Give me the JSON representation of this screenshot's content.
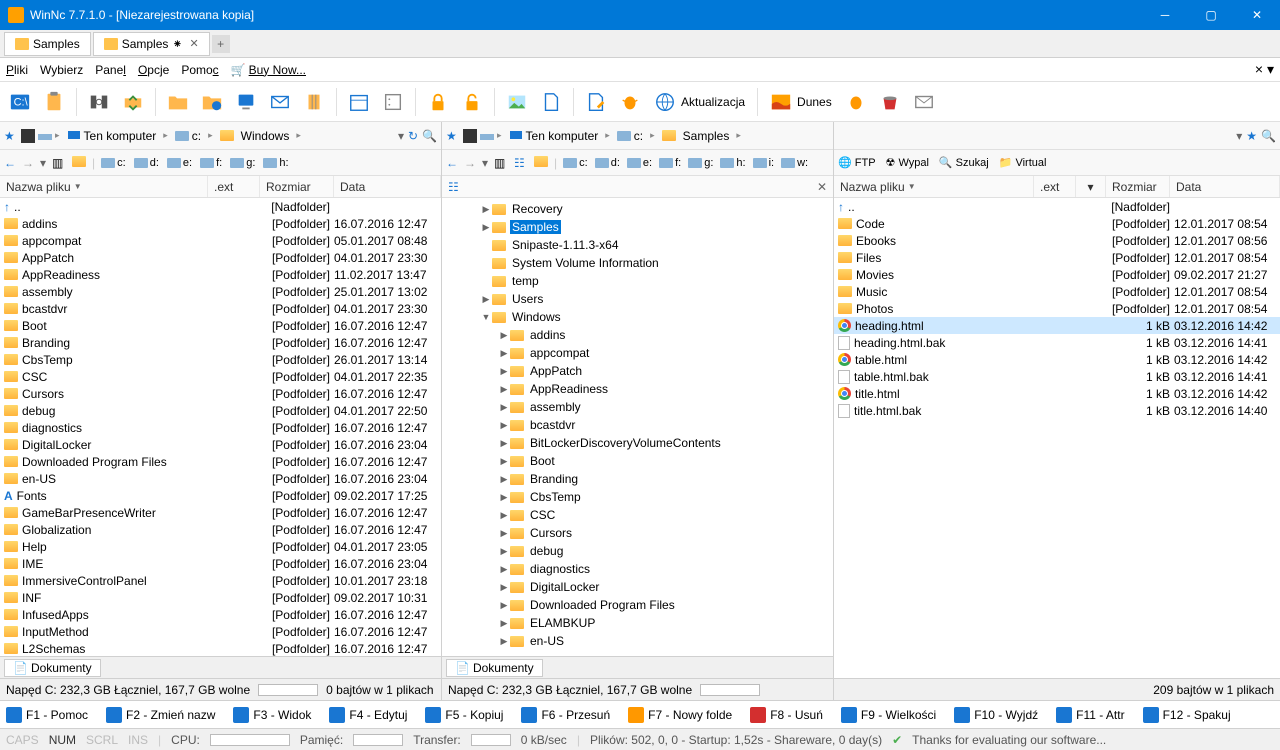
{
  "titlebar": {
    "title": "WinNc 7.7.1.0 - [Niezarejestrowana kopia]"
  },
  "tabs": [
    {
      "label": "Samples"
    },
    {
      "label": "Samples",
      "modified": true
    }
  ],
  "menu": {
    "file": "Pliki",
    "select": "Wybierz",
    "panel": "Panel",
    "options": "Opcje",
    "help": "Pomoc",
    "buy": "Buy Now..."
  },
  "toolbar_labels": {
    "update": "Aktualizacja",
    "dunes": "Dunes"
  },
  "left": {
    "breadcrumb": [
      "Ten komputer",
      "c:",
      "Windows"
    ],
    "drives": [
      "c:",
      "d:",
      "e:",
      "f:",
      "g:",
      "h:"
    ],
    "headers": {
      "name": "Nazwa pliku",
      "ext": ".ext",
      "size": "Rozmiar",
      "date": "Data"
    },
    "parent": {
      "name": "..",
      "size": "[Nadfolder]"
    },
    "rows": [
      {
        "name": "addins",
        "size": "[Podfolder]",
        "date": "16.07.2016 12:47"
      },
      {
        "name": "appcompat",
        "size": "[Podfolder]",
        "date": "05.01.2017 08:48"
      },
      {
        "name": "AppPatch",
        "size": "[Podfolder]",
        "date": "04.01.2017 23:30"
      },
      {
        "name": "AppReadiness",
        "size": "[Podfolder]",
        "date": "11.02.2017 13:47"
      },
      {
        "name": "assembly",
        "size": "[Podfolder]",
        "date": "25.01.2017 13:02"
      },
      {
        "name": "bcastdvr",
        "size": "[Podfolder]",
        "date": "04.01.2017 23:30"
      },
      {
        "name": "Boot",
        "size": "[Podfolder]",
        "date": "16.07.2016 12:47"
      },
      {
        "name": "Branding",
        "size": "[Podfolder]",
        "date": "16.07.2016 12:47"
      },
      {
        "name": "CbsTemp",
        "size": "[Podfolder]",
        "date": "26.01.2017 13:14"
      },
      {
        "name": "CSC",
        "size": "[Podfolder]",
        "date": "04.01.2017 22:35"
      },
      {
        "name": "Cursors",
        "size": "[Podfolder]",
        "date": "16.07.2016 12:47"
      },
      {
        "name": "debug",
        "size": "[Podfolder]",
        "date": "04.01.2017 22:50"
      },
      {
        "name": "diagnostics",
        "size": "[Podfolder]",
        "date": "16.07.2016 12:47"
      },
      {
        "name": "DigitalLocker",
        "size": "[Podfolder]",
        "date": "16.07.2016 23:04"
      },
      {
        "name": "Downloaded Program Files",
        "size": "[Podfolder]",
        "date": "16.07.2016 12:47"
      },
      {
        "name": "en-US",
        "size": "[Podfolder]",
        "date": "16.07.2016 23:04"
      },
      {
        "name": "Fonts",
        "size": "[Podfolder]",
        "date": "09.02.2017 17:25",
        "fonticon": true
      },
      {
        "name": "GameBarPresenceWriter",
        "size": "[Podfolder]",
        "date": "16.07.2016 12:47"
      },
      {
        "name": "Globalization",
        "size": "[Podfolder]",
        "date": "16.07.2016 12:47"
      },
      {
        "name": "Help",
        "size": "[Podfolder]",
        "date": "04.01.2017 23:05"
      },
      {
        "name": "IME",
        "size": "[Podfolder]",
        "date": "16.07.2016 23:04"
      },
      {
        "name": "ImmersiveControlPanel",
        "size": "[Podfolder]",
        "date": "10.01.2017 23:18"
      },
      {
        "name": "INF",
        "size": "[Podfolder]",
        "date": "09.02.2017 10:31"
      },
      {
        "name": "InfusedApps",
        "size": "[Podfolder]",
        "date": "16.07.2016 12:47"
      },
      {
        "name": "InputMethod",
        "size": "[Podfolder]",
        "date": "16.07.2016 12:47"
      },
      {
        "name": "L2Schemas",
        "size": "[Podfolder]",
        "date": "16.07.2016 12:47"
      }
    ],
    "tabstrip": "Dokumenty",
    "status": {
      "drive": "Napęd C: 232,3 GB Łączniel, 167,7 GB wolne",
      "sel": "0 bajtów w 1 plikach"
    }
  },
  "mid": {
    "tree": [
      {
        "indent": 1,
        "arrow": "▶",
        "name": "Recovery"
      },
      {
        "indent": 1,
        "arrow": "▶",
        "name": "Samples",
        "selected": true
      },
      {
        "indent": 1,
        "arrow": "",
        "name": "Snipaste-1.11.3-x64"
      },
      {
        "indent": 1,
        "arrow": "",
        "name": "System Volume Information"
      },
      {
        "indent": 1,
        "arrow": "",
        "name": "temp"
      },
      {
        "indent": 1,
        "arrow": "▶",
        "name": "Users"
      },
      {
        "indent": 1,
        "arrow": "▼",
        "name": "Windows"
      },
      {
        "indent": 2,
        "arrow": "▶",
        "name": "addins"
      },
      {
        "indent": 2,
        "arrow": "▶",
        "name": "appcompat"
      },
      {
        "indent": 2,
        "arrow": "▶",
        "name": "AppPatch"
      },
      {
        "indent": 2,
        "arrow": "▶",
        "name": "AppReadiness"
      },
      {
        "indent": 2,
        "arrow": "▶",
        "name": "assembly"
      },
      {
        "indent": 2,
        "arrow": "▶",
        "name": "bcastdvr"
      },
      {
        "indent": 2,
        "arrow": "▶",
        "name": "BitLockerDiscoveryVolumeContents"
      },
      {
        "indent": 2,
        "arrow": "▶",
        "name": "Boot"
      },
      {
        "indent": 2,
        "arrow": "▶",
        "name": "Branding"
      },
      {
        "indent": 2,
        "arrow": "▶",
        "name": "CbsTemp"
      },
      {
        "indent": 2,
        "arrow": "▶",
        "name": "CSC"
      },
      {
        "indent": 2,
        "arrow": "▶",
        "name": "Cursors"
      },
      {
        "indent": 2,
        "arrow": "▶",
        "name": "debug"
      },
      {
        "indent": 2,
        "arrow": "▶",
        "name": "diagnostics"
      },
      {
        "indent": 2,
        "arrow": "▶",
        "name": "DigitalLocker"
      },
      {
        "indent": 2,
        "arrow": "▶",
        "name": "Downloaded Program Files"
      },
      {
        "indent": 2,
        "arrow": "▶",
        "name": "ELAMBKUP"
      },
      {
        "indent": 2,
        "arrow": "▶",
        "name": "en-US"
      }
    ]
  },
  "right": {
    "breadcrumb": [
      "Ten komputer",
      "c:",
      "Samples"
    ],
    "drives": [
      "c:",
      "d:",
      "e:",
      "f:",
      "g:",
      "h:",
      "i:",
      "w:"
    ],
    "netdrives": [
      {
        "ico": "ftp",
        "label": "FTP"
      },
      {
        "ico": "nuke",
        "label": "Wypal"
      },
      {
        "ico": "search",
        "label": "Szukaj"
      },
      {
        "ico": "virt",
        "label": "Virtual"
      }
    ],
    "headers": {
      "name": "Nazwa pliku",
      "ext": ".ext",
      "size": "Rozmiar",
      "date": "Data"
    },
    "parent": {
      "name": "..",
      "size": "[Nadfolder]"
    },
    "rows": [
      {
        "ico": "folder",
        "name": "Code",
        "size": "[Podfolder]",
        "date": "12.01.2017 08:54"
      },
      {
        "ico": "folder",
        "name": "Ebooks",
        "size": "[Podfolder]",
        "date": "12.01.2017 08:56"
      },
      {
        "ico": "folder",
        "name": "Files",
        "size": "[Podfolder]",
        "date": "12.01.2017 08:54"
      },
      {
        "ico": "folder",
        "name": "Movies",
        "size": "[Podfolder]",
        "date": "09.02.2017 21:27"
      },
      {
        "ico": "folder",
        "name": "Music",
        "size": "[Podfolder]",
        "date": "12.01.2017 08:54"
      },
      {
        "ico": "folder",
        "name": "Photos",
        "size": "[Podfolder]",
        "date": "12.01.2017 08:54"
      },
      {
        "ico": "chrome",
        "name": "heading.html",
        "size": "1 kB",
        "date": "03.12.2016 14:42",
        "selected": true
      },
      {
        "ico": "file",
        "name": "heading.html.bak",
        "size": "1 kB",
        "date": "03.12.2016 14:41"
      },
      {
        "ico": "chrome",
        "name": "table.html",
        "size": "1 kB",
        "date": "03.12.2016 14:42"
      },
      {
        "ico": "file",
        "name": "table.html.bak",
        "size": "1 kB",
        "date": "03.12.2016 14:41"
      },
      {
        "ico": "chrome",
        "name": "title.html",
        "size": "1 kB",
        "date": "03.12.2016 14:42"
      },
      {
        "ico": "file",
        "name": "title.html.bak",
        "size": "1 kB",
        "date": "03.12.2016 14:40"
      }
    ],
    "tabstrip": "Dokumenty",
    "status": {
      "drive": "Napęd C: 232,3 GB Łączniel, 167,7 GB wolne",
      "sel": "209 bajtów w 1 plikach"
    }
  },
  "fkeys": [
    {
      "k": "F1",
      "l": "Pomoc"
    },
    {
      "k": "F2",
      "l": "Zmień nazw"
    },
    {
      "k": "F3",
      "l": "Widok"
    },
    {
      "k": "F4",
      "l": "Edytuj"
    },
    {
      "k": "F5",
      "l": "Kopiuj"
    },
    {
      "k": "F6",
      "l": "Przesuń"
    },
    {
      "k": "F7",
      "l": "Nowy folde"
    },
    {
      "k": "F8",
      "l": "Usuń"
    },
    {
      "k": "F9",
      "l": "Wielkości"
    },
    {
      "k": "F10",
      "l": "Wyjdź"
    },
    {
      "k": "F11",
      "l": "Attr"
    },
    {
      "k": "F12",
      "l": "Spakuj"
    }
  ],
  "bottom": {
    "caps": "CAPS",
    "num": "NUM",
    "scrl": "SCRL",
    "ins": "INS",
    "cpu": "CPU:",
    "mem": "Pamięć:",
    "transfer": "Transfer:",
    "kbsec": "0 kB/sec",
    "info": "Plików: 502, 0, 0 - Startup: 1,52s - Shareware, 0 day(s)",
    "thanks": "Thanks for evaluating our software..."
  }
}
